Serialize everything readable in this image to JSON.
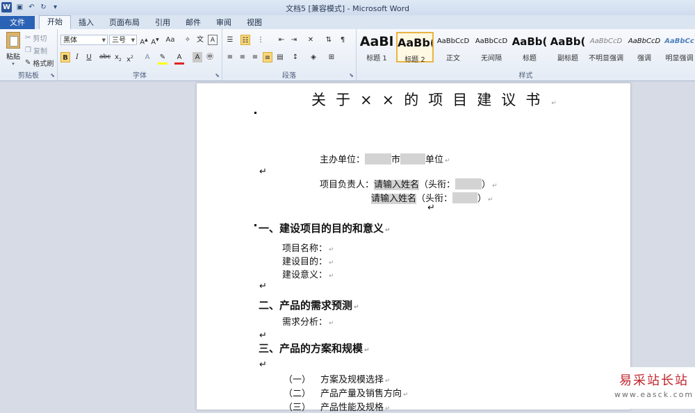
{
  "window": {
    "title": "文档5 [兼容模式] - Microsoft Word",
    "app_logo": "W"
  },
  "tabs": [
    "文件",
    "开始",
    "插入",
    "页面布局",
    "引用",
    "邮件",
    "审阅",
    "视图"
  ],
  "ribbon": {
    "clipboard": {
      "label": "剪贴板",
      "paste": "粘贴",
      "cut": "剪切",
      "copy": "复制",
      "format_painter": "格式刷"
    },
    "font": {
      "label": "字体",
      "font_name": "黑体",
      "font_size": "三号"
    },
    "paragraph": {
      "label": "段落"
    },
    "styles": {
      "label": "样式",
      "items": [
        {
          "sample": "AaBl",
          "name": "标题 1"
        },
        {
          "sample": "AaBb(",
          "name": "标题 2"
        },
        {
          "sample": "AaBbCcD",
          "name": "正文"
        },
        {
          "sample": "AaBbCcD",
          "name": "无间隔"
        },
        {
          "sample": "AaBb(",
          "name": "标题"
        },
        {
          "sample": "AaBb(",
          "name": "副标题"
        },
        {
          "sample": "AaBbCcD",
          "name": "不明显强调"
        },
        {
          "sample": "AaBbCcD",
          "name": "强调"
        },
        {
          "sample": "AaBbCc",
          "name": "明显强调"
        }
      ]
    }
  },
  "document": {
    "title": "关于××的项目建议书",
    "sponsor": {
      "label": "主办单位：",
      "mid": "市",
      "end": "单位"
    },
    "leader": {
      "label": "项目负责人：",
      "name_placeholder": "请输入姓名",
      "title_open": "（头衔：",
      "title_close": "）"
    },
    "sections": [
      {
        "heading": "一、建设项目的目的和意义",
        "lines": [
          "项目名称：",
          "建设目的：",
          "建设意义："
        ]
      },
      {
        "heading": "二、产品的需求预测",
        "lines": [
          "需求分析："
        ]
      },
      {
        "heading": "三、产品的方案和规模",
        "lines": []
      }
    ],
    "subitems": [
      {
        "num": "（一）",
        "text": "方案及规模选择"
      },
      {
        "num": "（二）",
        "text": "产品产量及销售方向"
      },
      {
        "num": "（三）",
        "text": "产品性能及规格"
      }
    ],
    "pilcrow": "↵"
  },
  "watermark": {
    "main": "易采站长站",
    "url": "www.easck.com"
  }
}
